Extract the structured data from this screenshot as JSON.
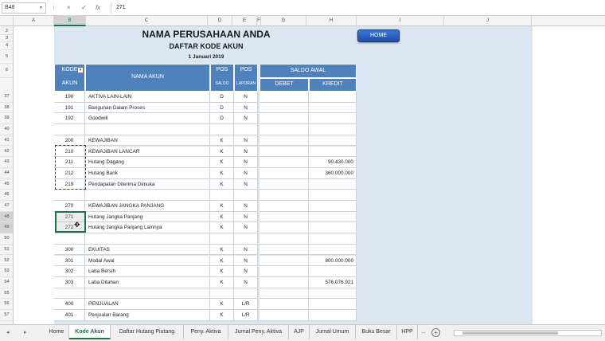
{
  "formula_bar": {
    "cell_ref": "B48",
    "cancel_icon": "×",
    "enter_icon": "✓",
    "fx_label": "fx",
    "value": "271"
  },
  "columns": [
    "A",
    "B",
    "C",
    "D",
    "E",
    "F",
    "G",
    "H",
    "I",
    "J"
  ],
  "header_rows": [
    "2",
    "3",
    "4",
    "5",
    "6"
  ],
  "titles": {
    "company": "NAMA PERUSAHAAN ANDA",
    "subtitle": "DAFTAR KODE AKUN",
    "date": "1 Januari 2019"
  },
  "home_button": "HOME",
  "table_header": {
    "kode_top": "KODE",
    "kode_bottom": "AKUN",
    "nama": "NAMA AKUN",
    "pos_1": "POS",
    "saldo": "SALDO",
    "pos_2": "POS",
    "laporan": "LAPORAN",
    "saldo_awal": "SALDO AWAL",
    "debet": "DEBET",
    "kredit": "KREDIT"
  },
  "rows": [
    {
      "row": "37",
      "kode": "190",
      "nama": "AKTIVA LAIN-LAIN",
      "saldo": "D",
      "laporan": "N",
      "debet": "",
      "kredit": ""
    },
    {
      "row": "38",
      "kode": "191",
      "nama": "Bangunan Dalam Proses",
      "saldo": "D",
      "laporan": "N",
      "debet": "",
      "kredit": ""
    },
    {
      "row": "39",
      "kode": "192",
      "nama": "Goodwill",
      "saldo": "D",
      "laporan": "N",
      "debet": "",
      "kredit": ""
    },
    {
      "row": "40",
      "kode": "",
      "nama": "",
      "saldo": "",
      "laporan": "",
      "debet": "",
      "kredit": ""
    },
    {
      "row": "41",
      "kode": "200",
      "nama": "KEWAJIBAN",
      "saldo": "K",
      "laporan": "N",
      "debet": "",
      "kredit": ""
    },
    {
      "row": "42",
      "kode": "210",
      "nama": "KEWAJIBAN LANCAR",
      "saldo": "K",
      "laporan": "N",
      "debet": "",
      "kredit": ""
    },
    {
      "row": "43",
      "kode": "211",
      "nama": "Hutang Dagang",
      "saldo": "K",
      "laporan": "N",
      "debet": "",
      "kredit": "90.430.000"
    },
    {
      "row": "44",
      "kode": "212",
      "nama": "Hutang Bank",
      "saldo": "K",
      "laporan": "N",
      "debet": "",
      "kredit": "360.000.000"
    },
    {
      "row": "45",
      "kode": "219",
      "nama": "Pendapatan Diterima Dimuka",
      "saldo": "K",
      "laporan": "N",
      "debet": "",
      "kredit": ""
    },
    {
      "row": "46",
      "kode": "",
      "nama": "",
      "saldo": "",
      "laporan": "",
      "debet": "",
      "kredit": ""
    },
    {
      "row": "47",
      "kode": "270",
      "nama": "KEWAJIBAN JANGKA PANJANG",
      "saldo": "K",
      "laporan": "N",
      "debet": "",
      "kredit": ""
    },
    {
      "row": "48",
      "kode": "271",
      "nama": "Hutang Jangka Panjang",
      "saldo": "K",
      "laporan": "N",
      "debet": "",
      "kredit": ""
    },
    {
      "row": "49",
      "kode": "272",
      "nama": "Hutang Jangka Panjang Lainnya",
      "saldo": "K",
      "laporan": "N",
      "debet": "",
      "kredit": ""
    },
    {
      "row": "50",
      "kode": "",
      "nama": "",
      "saldo": "",
      "laporan": "",
      "debet": "",
      "kredit": ""
    },
    {
      "row": "51",
      "kode": "300",
      "nama": "EKUITAS",
      "saldo": "K",
      "laporan": "N",
      "debet": "",
      "kredit": ""
    },
    {
      "row": "52",
      "kode": "301",
      "nama": "Modal Awal",
      "saldo": "K",
      "laporan": "N",
      "debet": "",
      "kredit": "800.000.000"
    },
    {
      "row": "53",
      "kode": "302",
      "nama": "Laba Bersih",
      "saldo": "K",
      "laporan": "N",
      "debet": "",
      "kredit": ""
    },
    {
      "row": "54",
      "kode": "303",
      "nama": "Laba Ditahan",
      "saldo": "K",
      "laporan": "N",
      "debet": "",
      "kredit": "576.076.921"
    },
    {
      "row": "55",
      "kode": "",
      "nama": "",
      "saldo": "",
      "laporan": "",
      "debet": "",
      "kredit": ""
    },
    {
      "row": "56",
      "kode": "400",
      "nama": "PENJUALAN",
      "saldo": "K",
      "laporan": "L/R",
      "debet": "",
      "kredit": ""
    },
    {
      "row": "57",
      "kode": "401",
      "nama": "Penjualan Barang",
      "saldo": "K",
      "laporan": "L/R",
      "debet": "",
      "kredit": ""
    }
  ],
  "tabs": [
    "Home",
    "Kode Akun",
    "Daftar Hutang Piutang",
    "Peny. Aktiva",
    "Jurnal Peny. Aktiva",
    "AJP",
    "Jurnal Umum",
    "Buku Besar",
    "HPP",
    "..."
  ],
  "active_tab": "Kode Akun",
  "tab_nav": {
    "prev": "◂",
    "next": "▸"
  },
  "add_sheet": "+",
  "colors": {
    "header_blue": "#4f81bd",
    "sheet_bg": "#dce6f1",
    "button_blue": "#2f63c0",
    "excel_green": "#217346"
  }
}
